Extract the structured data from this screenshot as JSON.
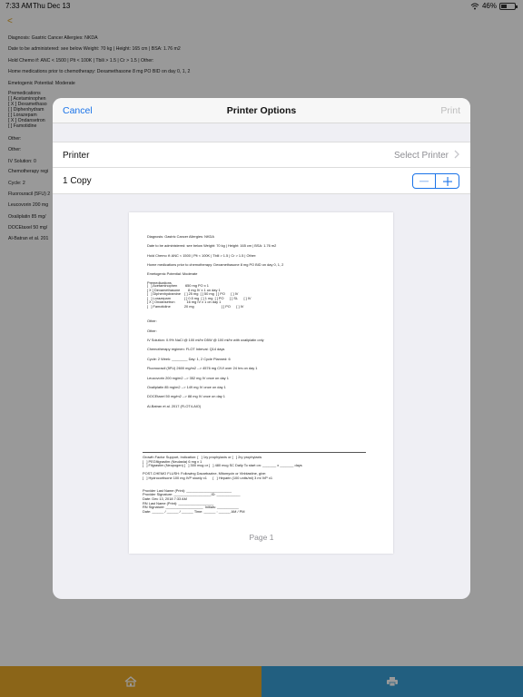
{
  "status_bar": {
    "time": "7:33 AM",
    "date": "Thu Dec 13",
    "battery": "46%",
    "battery_level": 0.46
  },
  "background_doc": {
    "back_glyph": "<",
    "lines": [
      "Diagnosis: Gastric Cancer          Allergies: NKDA",
      "Date to be administered: see below                                                Weight: 70 kg  |  Height: 165 cm  |  BSA: 1.76 m2",
      "Hold Chemo if:  ANC < 1500  |  Plt < 100K  |  Tbili > 1.5  |  Cr > 1.5  |  Other:",
      "Home medications prior to chemotherapy: Dexamethasone 8 mg PO BID on day 0, 1, 2",
      "Emetogenic Potential: Moderate",
      "Premedications",
      "[   ] Acetaminophen",
      "[ X ] Dexamethaso",
      "[   ] Diphenhydram",
      "[   ] Lorazepam",
      "[ X ] Ondansetron",
      "[   ] Famotidine",
      "Other:",
      "Other:",
      "IV Solution:        0",
      "Chemotherapy regi",
      "Cycle: 2",
      "Fluorouracil (5FU) 2",
      "Leucovorin 200 mg",
      "Oxaliplatin 85 mg/",
      "DOCEtaxel 50 mg/",
      "Al-Batran et al. 201"
    ]
  },
  "modal": {
    "cancel_label": "Cancel",
    "title": "Printer Options",
    "print_label": "Print",
    "printer_label": "Printer",
    "printer_value": "Select Printer",
    "copies_label": "1 Copy",
    "copies": 1,
    "page_label": "Page 1",
    "accent_color": "#1a73e8"
  },
  "preview": {
    "diagnosis": "Diagnosis: Gastric Cancer          Allergies: NKDA",
    "date_weight": "Date to be administered: see below                                     Weight: 70 kg  |  Height: 165 cm  |  BSA: 1.76 m2",
    "hold": "Hold Chemo if:  ANC < 1500  |  Plt < 100K  |  Tbili > 1.5  |  Cr > 1.5  |  Other:",
    "home_meds": "Home medications prior to chemotherapy: Dexamethasone 8 mg PO BID on day 0, 1, 2",
    "emetogenic": "Emetogenic Potential: Moderate",
    "premeds_title": "Premedications",
    "premeds": "[   ] Acetaminophen        650 mg PO x 1\n[ X ] Dexamethasone        8 mg IV x 1 on day 1\n[   ] Diphenhydramine    [ ] 25 mg  [ ] 50 mg  [ ] PO      [ ] IV\n[   ] Lorazepam              [ ] 0.5 mg  [ ] 1 mg  [ ] PO      [ ] SL      [ ] IV\n[ X ] Ondansetron            16 mg IV x 1 on day 1\n[   ] Famotidine              20 mg                            [ ] PO      [ ] IV",
    "other1": "Other:",
    "other2": "Other:",
    "iv": "IV Solution:          0.9% NaCl @ 100 ml/hr          D5W @ 100 ml/hr  with oxaliplatin only",
    "regimen": "Chemotherapy regimen:  FLOT                                Interval: Q14 days",
    "cycle": "Cycle: 2                              Week: ________                    Day: 1, 2                       Cycle Planned: 6",
    "drug1": "Fluorouracil (5FU) 2600 mg/m2 --> 4576 mg CIVI over 24 hrs on day 1",
    "drug2": "Leucovorin 200 mg/m2 --> 352 mg IV once on day 1",
    "drug3": "Oxaliplatin 85 mg/m2 --> 149 mg IV once on day 1",
    "drug4": "DOCEtaxel 50 mg/m2 --> 88 mg IV once on day 1",
    "reference": "Al-Batran et al. 2017 (FLOT4-AIO)",
    "footer": "Growth Factor Support, Indication: [   ] 1ry prophylaxis or [   ] 2ry prophylaxis\n[   ] PEGfilgrastim (Neulasta) 6 mg x 1\n[   ] Filgrastim (Neupogen) [   ] 300 mcg or [   ] 480 mcg SC Daily To start on: _______ x _______ days\n\nPOST-CHEMO FLUSH: Following Dacarbazine, Mitomycin or Vinblastine, give:\n[   ] Hydrocortisone 100 mg IVP slowly x1      [   ] Heparin (100 units/ml) 3 ml IVP x1\n\n\nProvider Last Name (Print): _______________________\nProvider Signature: ___________________ID: ____________\nDate: Dec 13, 2018 7:33 AM\nRN Last Name (Print): __________________\nRN Signature: ___________________  Initials: ___________\nDate: ______ / ______ / ______ Time: ______ : ______ AM / PM"
  },
  "bottom_bar": {
    "home_color": "#e8a828",
    "print_color": "#3a9fd6",
    "home_icon": "home-icon",
    "print_icon": "printer-icon"
  }
}
